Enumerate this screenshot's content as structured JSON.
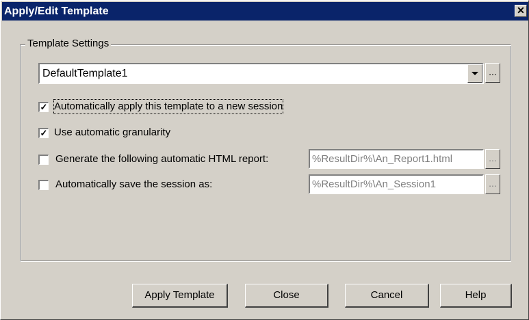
{
  "window": {
    "title": "Apply/Edit Template",
    "close_glyph": "✕"
  },
  "group": {
    "title": "Template Settings"
  },
  "template_select": {
    "selected": "DefaultTemplate1",
    "browse_label": "..."
  },
  "options": [
    {
      "label": "Automatically apply this template to a new session",
      "checked": true
    },
    {
      "label": "Use automatic granularity",
      "checked": true
    },
    {
      "label": "Generate the following automatic HTML report:",
      "checked": false
    },
    {
      "label": "Automatically save the session as:",
      "checked": false
    }
  ],
  "report_path": {
    "value": "%ResultDir%\\An_Report1.html",
    "browse_label": "..."
  },
  "session_path": {
    "value": "%ResultDir%\\An_Session1",
    "browse_label": "..."
  },
  "buttons": {
    "apply": "Apply Template",
    "close": "Close",
    "cancel": "Cancel",
    "help": "Help"
  },
  "check_glyph": "✓",
  "icons": {
    "dropdown": "chevron-down-icon",
    "close": "close-icon"
  }
}
